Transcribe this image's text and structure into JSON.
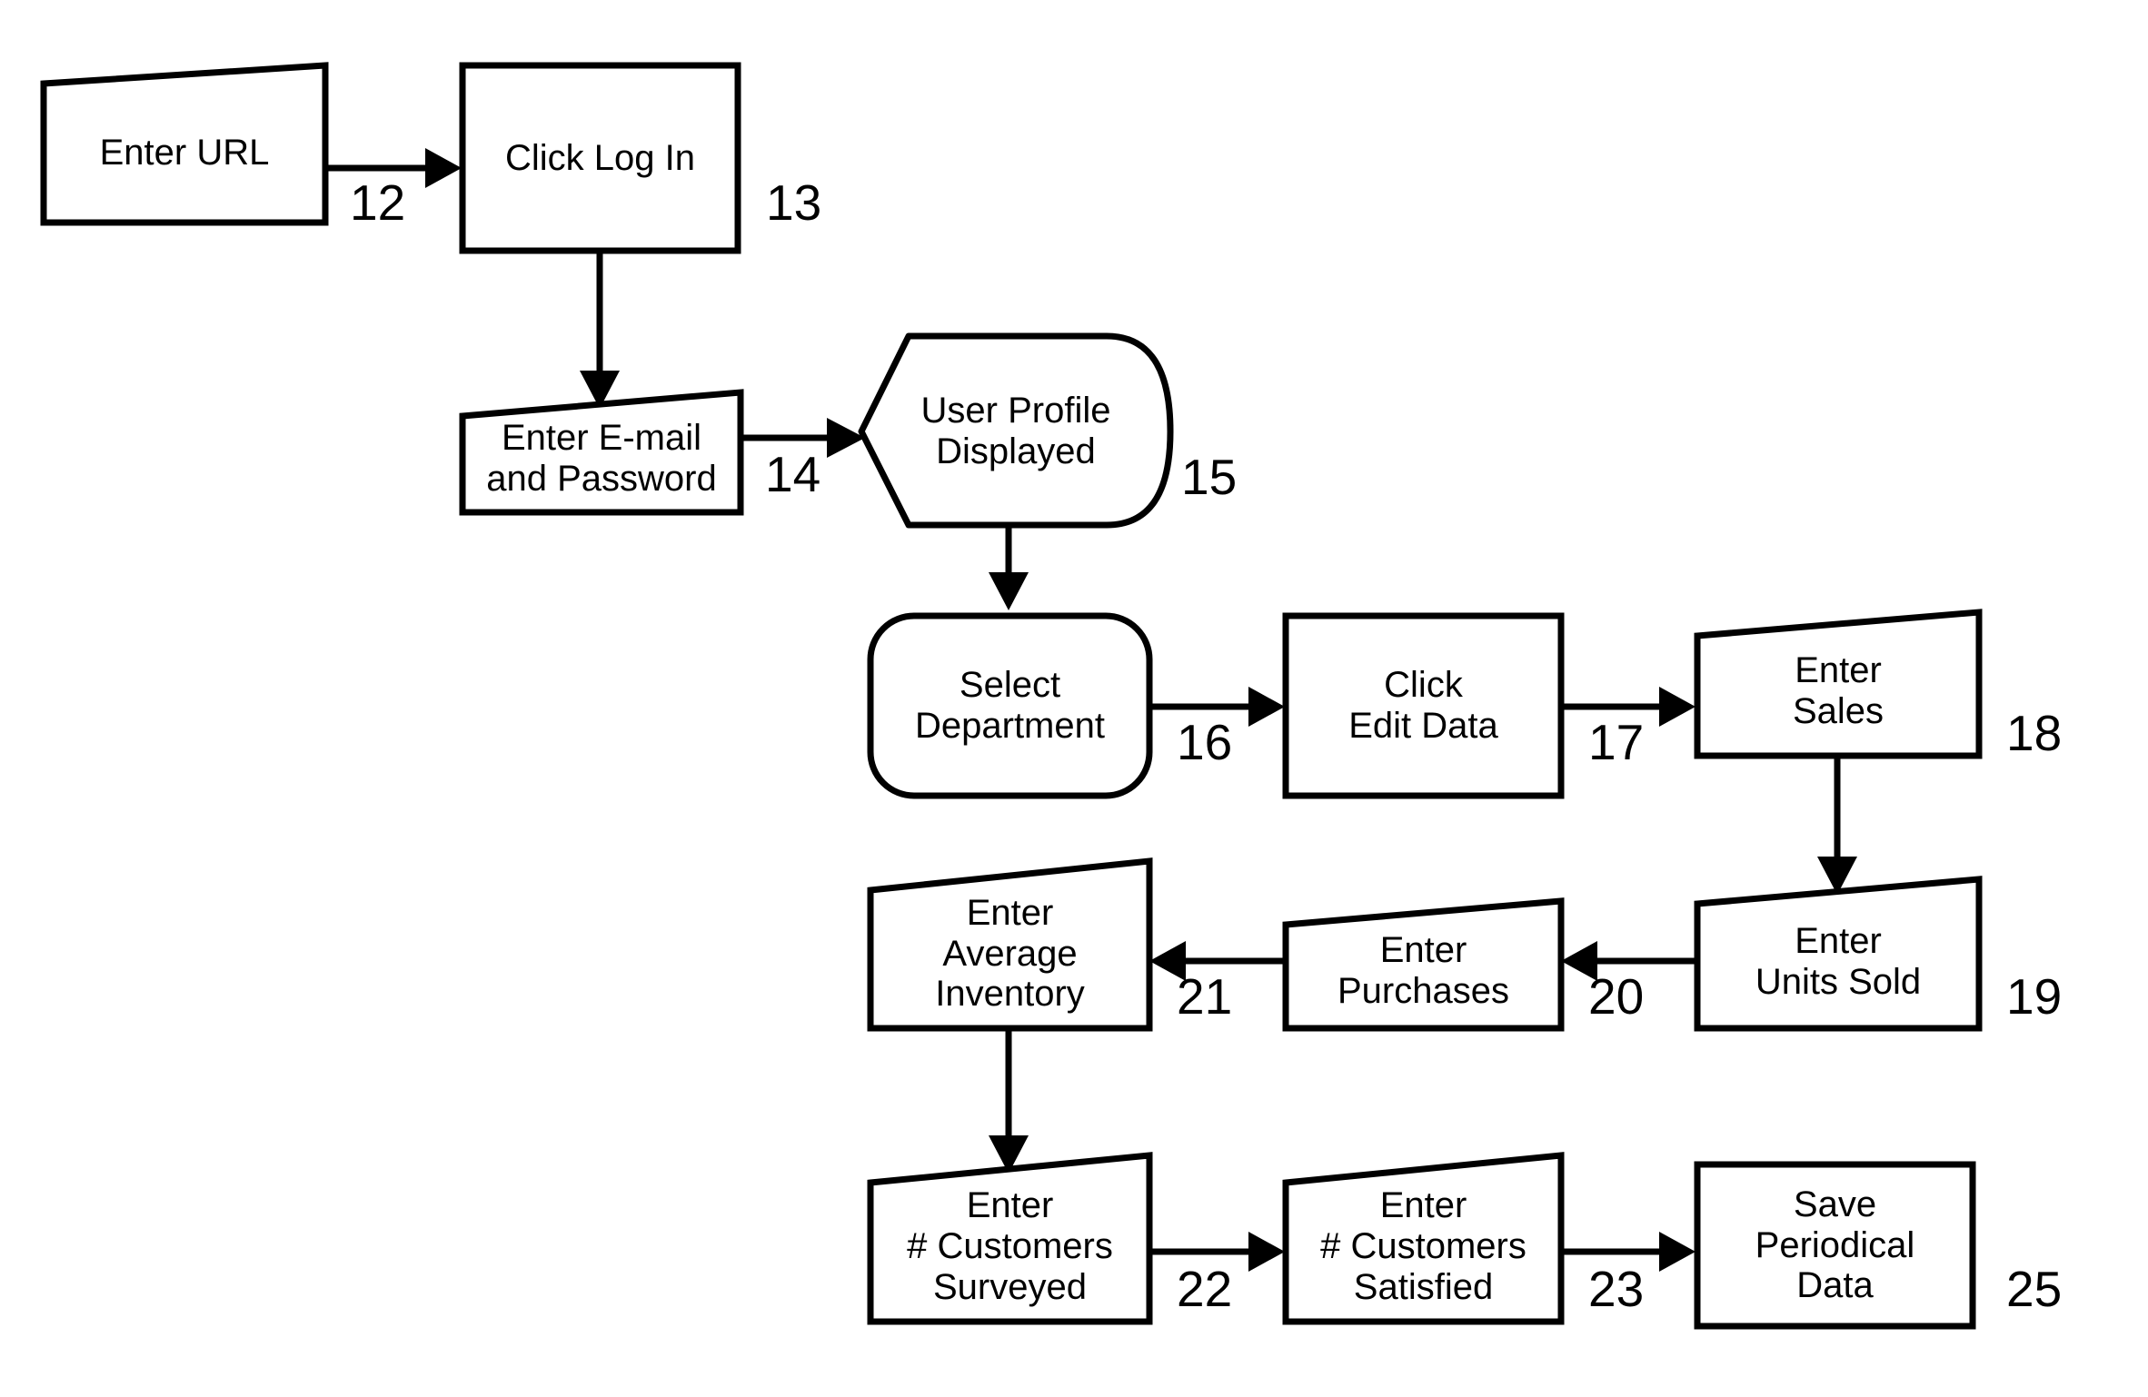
{
  "diagram": {
    "title": "Data Entry Process Flowchart",
    "background_color": "#ffffff",
    "line_color": "#000000",
    "nodes": [
      {
        "id": "enter-url",
        "label": "Enter URL",
        "shape": "manual-input"
      },
      {
        "id": "click-log-in",
        "label": "Click Log In",
        "shape": "process"
      },
      {
        "id": "enter-email-password",
        "label": "Enter E-mail\nand Password",
        "shape": "manual-input"
      },
      {
        "id": "user-profile",
        "label": "User Profile\nDisplayed",
        "shape": "display"
      },
      {
        "id": "select-department",
        "label": "Select\nDepartment",
        "shape": "rounded-process"
      },
      {
        "id": "click-edit-data",
        "label": "Click\nEdit Data",
        "shape": "process"
      },
      {
        "id": "enter-sales",
        "label": "Enter\nSales",
        "shape": "manual-input"
      },
      {
        "id": "enter-units-sold",
        "label": "Enter\nUnits Sold",
        "shape": "manual-input"
      },
      {
        "id": "enter-purchases",
        "label": "Enter\nPurchases",
        "shape": "manual-input"
      },
      {
        "id": "enter-avg-inventory",
        "label": "Enter\nAverage\nInventory",
        "shape": "manual-input"
      },
      {
        "id": "enter-cust-surveyed",
        "label": "Enter\n# Customers\nSurveyed",
        "shape": "manual-input"
      },
      {
        "id": "enter-cust-satisfied",
        "label": "Enter\n# Customers\nSatisfied",
        "shape": "manual-input"
      },
      {
        "id": "save-periodical-data",
        "label": "Save\nPeriodical\nData",
        "shape": "process"
      }
    ],
    "reference_numbers": [
      {
        "id": "ref-12",
        "value": "12"
      },
      {
        "id": "ref-13",
        "value": "13"
      },
      {
        "id": "ref-14",
        "value": "14"
      },
      {
        "id": "ref-15",
        "value": "15"
      },
      {
        "id": "ref-16",
        "value": "16"
      },
      {
        "id": "ref-17",
        "value": "17"
      },
      {
        "id": "ref-18",
        "value": "18"
      },
      {
        "id": "ref-19",
        "value": "19"
      },
      {
        "id": "ref-20",
        "value": "20"
      },
      {
        "id": "ref-21",
        "value": "21"
      },
      {
        "id": "ref-22",
        "value": "22"
      },
      {
        "id": "ref-23",
        "value": "23"
      },
      {
        "id": "ref-25",
        "value": "25"
      }
    ],
    "connectors": [
      {
        "id": "conn-12",
        "from": "enter-url",
        "to": "click-log-in",
        "direction": "right",
        "ref": "12"
      },
      {
        "id": "conn-13",
        "from": "click-log-in",
        "to": "enter-email-password",
        "direction": "down",
        "ref": "13"
      },
      {
        "id": "conn-14",
        "from": "enter-email-password",
        "to": "user-profile",
        "direction": "right",
        "ref": "14"
      },
      {
        "id": "conn-15",
        "from": "user-profile",
        "to": "select-department",
        "direction": "down",
        "ref": "15"
      },
      {
        "id": "conn-16",
        "from": "select-department",
        "to": "click-edit-data",
        "direction": "right",
        "ref": "16"
      },
      {
        "id": "conn-17",
        "from": "click-edit-data",
        "to": "enter-sales",
        "direction": "right",
        "ref": "17"
      },
      {
        "id": "conn-18",
        "from": "enter-sales",
        "to": "enter-units-sold",
        "direction": "down",
        "ref": "18"
      },
      {
        "id": "conn-20",
        "from": "enter-units-sold",
        "to": "enter-purchases",
        "direction": "left",
        "ref": "20"
      },
      {
        "id": "conn-21",
        "from": "enter-purchases",
        "to": "enter-avg-inventory",
        "direction": "left",
        "ref": "21"
      },
      {
        "id": "conn-22",
        "from": "enter-avg-inventory",
        "to": "enter-cust-surveyed",
        "direction": "down",
        "ref": "22"
      },
      {
        "id": "conn-23",
        "from": "enter-cust-surveyed",
        "to": "enter-cust-satisfied",
        "direction": "right",
        "ref": "23"
      },
      {
        "id": "conn-25",
        "from": "enter-cust-satisfied",
        "to": "save-periodical-data",
        "direction": "right",
        "ref": "25"
      }
    ]
  }
}
